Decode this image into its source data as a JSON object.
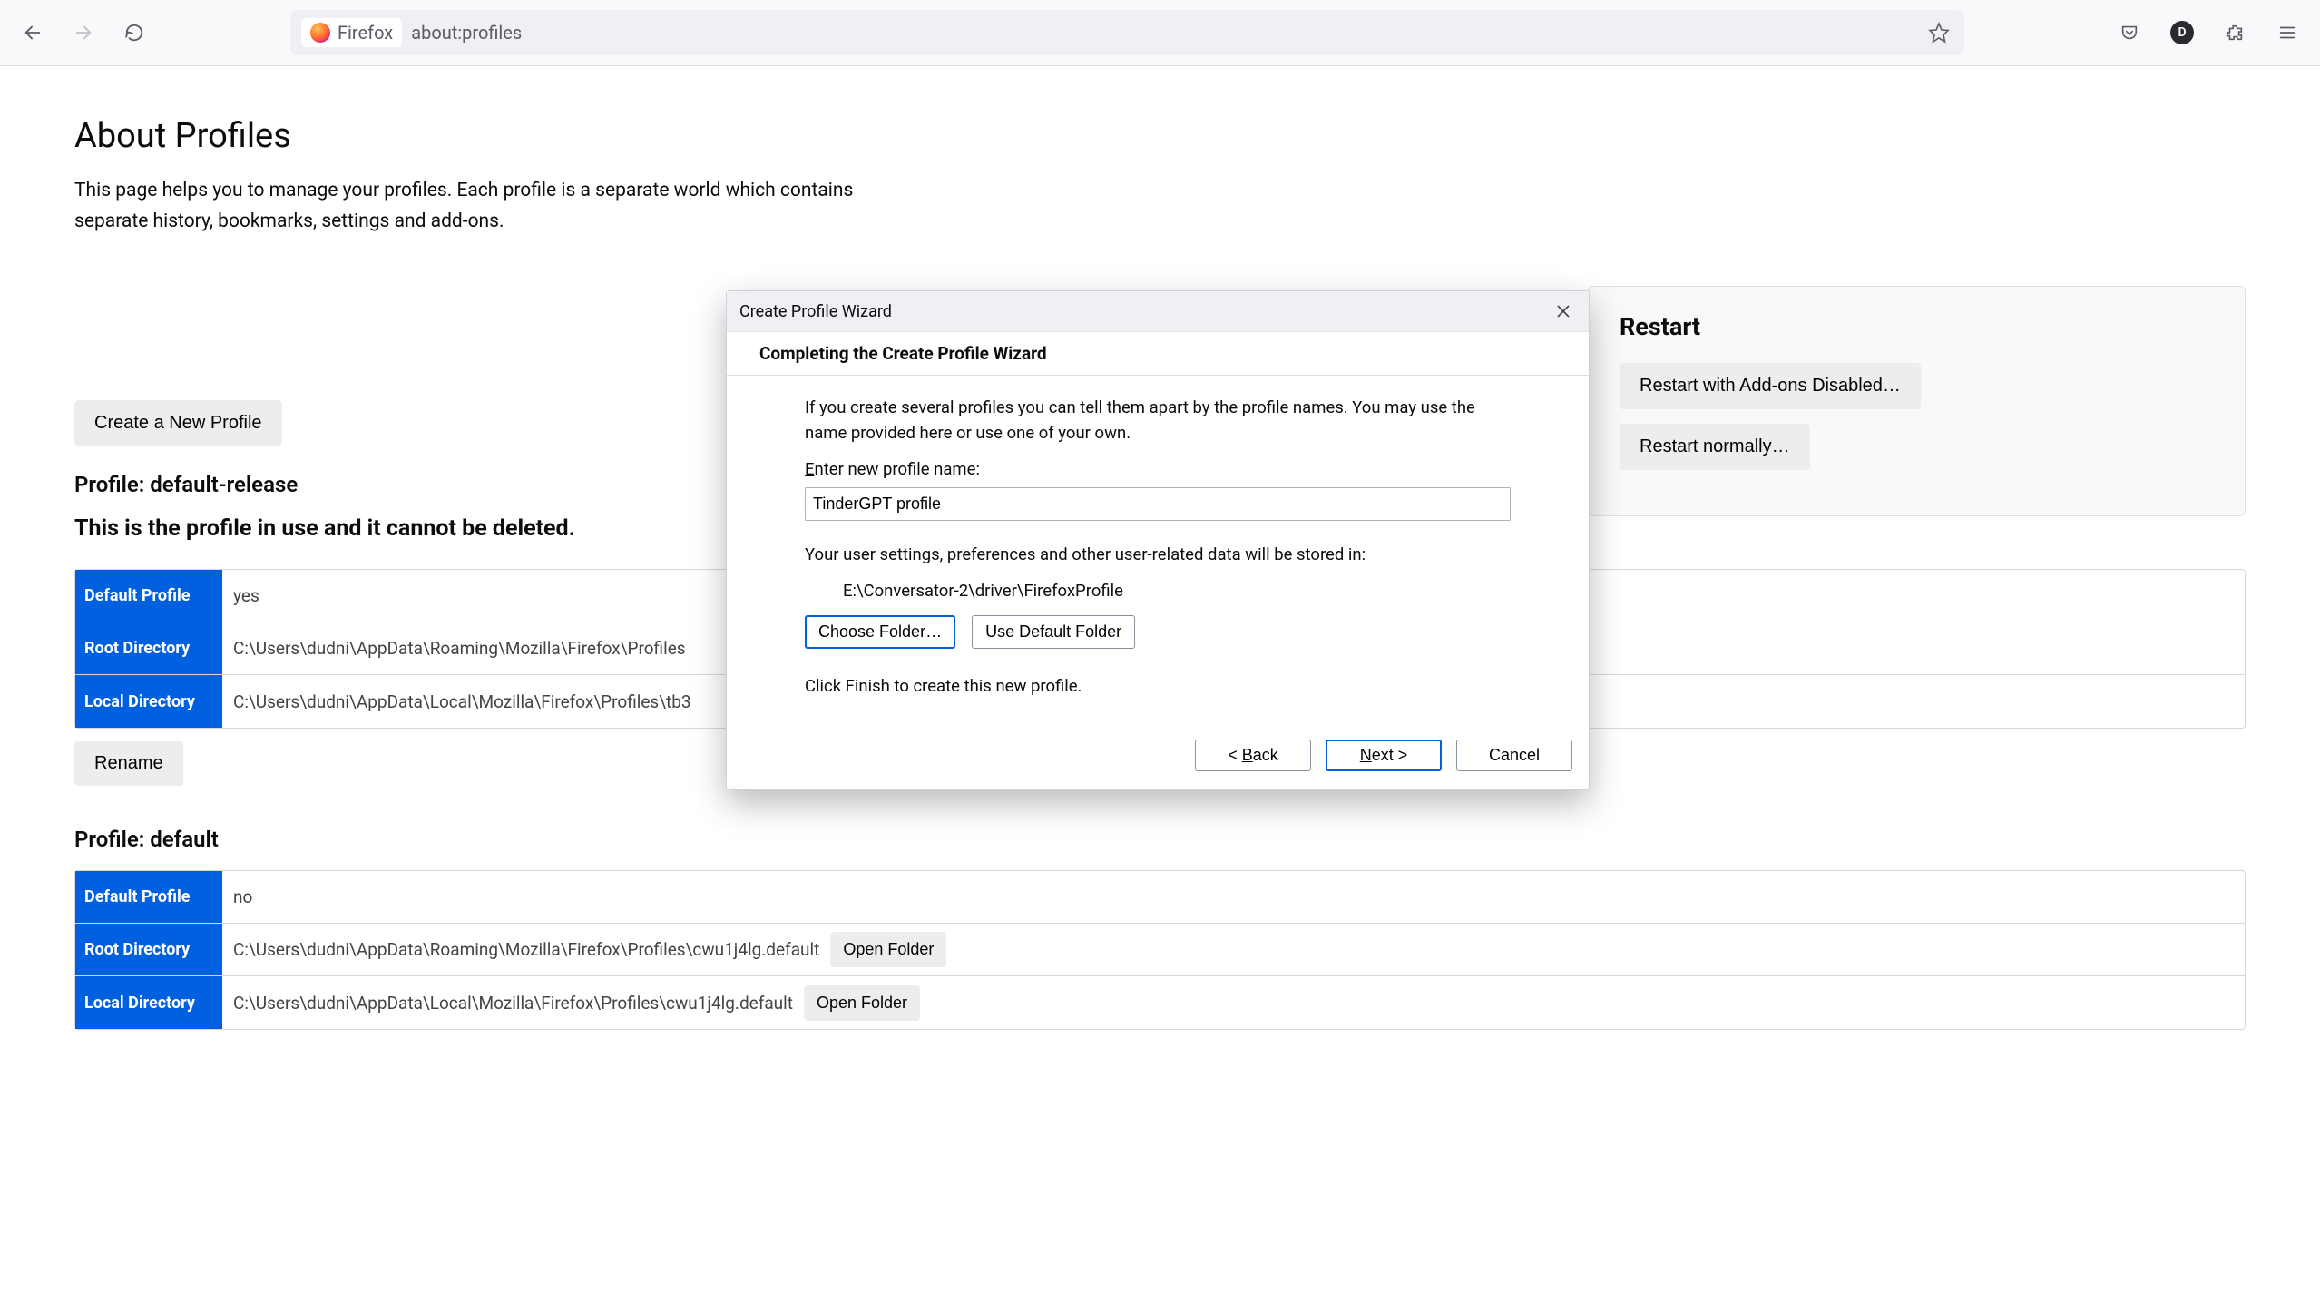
{
  "toolbar": {
    "identity_label": "Firefox",
    "url": "about:profiles",
    "avatar_letter": "D"
  },
  "page": {
    "title": "About Profiles",
    "description": "This page helps you to manage your profiles. Each profile is a separate world which contains separate history, bookmarks, settings and add-ons.",
    "create_button": "Create a New Profile"
  },
  "restart": {
    "title": "Restart",
    "addons_disabled": "Restart with Add-ons Disabled…",
    "normally": "Restart normally…"
  },
  "profiles": [
    {
      "heading": "Profile: default-release",
      "in_use_text": "This is the profile in use and it cannot be deleted.",
      "rows": {
        "default_profile_label": "Default Profile",
        "default_profile_value": "yes",
        "root_label": "Root Directory",
        "root_value": "C:\\Users\\dudni\\AppData\\Roaming\\Mozilla\\Firefox\\Profiles",
        "local_label": "Local Directory",
        "local_value": "C:\\Users\\dudni\\AppData\\Local\\Mozilla\\Firefox\\Profiles\\tb3"
      },
      "rename": "Rename"
    },
    {
      "heading": "Profile: default",
      "rows": {
        "default_profile_label": "Default Profile",
        "default_profile_value": "no",
        "root_label": "Root Directory",
        "root_value": "C:\\Users\\dudni\\AppData\\Roaming\\Mozilla\\Firefox\\Profiles\\cwu1j4lg.default",
        "local_label": "Local Directory",
        "local_value": "C:\\Users\\dudni\\AppData\\Local\\Mozilla\\Firefox\\Profiles\\cwu1j4lg.default"
      },
      "open_folder": "Open Folder"
    }
  ],
  "dialog": {
    "titlebar": "Create Profile Wizard",
    "step_heading": "Completing the Create Profile Wizard",
    "intro": "If you create several profiles you can tell them apart by the profile names. You may use the name provided here or use one of your own.",
    "name_label_pre": "E",
    "name_label_rest": "nter new profile name:",
    "name_value": "TinderGPT profile",
    "storage_intro": "Your user settings, preferences and other user-related data will be stored in:",
    "storage_path": "E:\\Conversator-2\\driver\\FirefoxProfile",
    "choose_folder": "Choose Folder…",
    "use_default": "Use Default Folder",
    "finish_hint": "Click Finish to create this new profile.",
    "back_pre": "< ",
    "back_u": "B",
    "back_rest": "ack",
    "next_u": "N",
    "next_rest": "ext >",
    "cancel": "Cancel"
  }
}
